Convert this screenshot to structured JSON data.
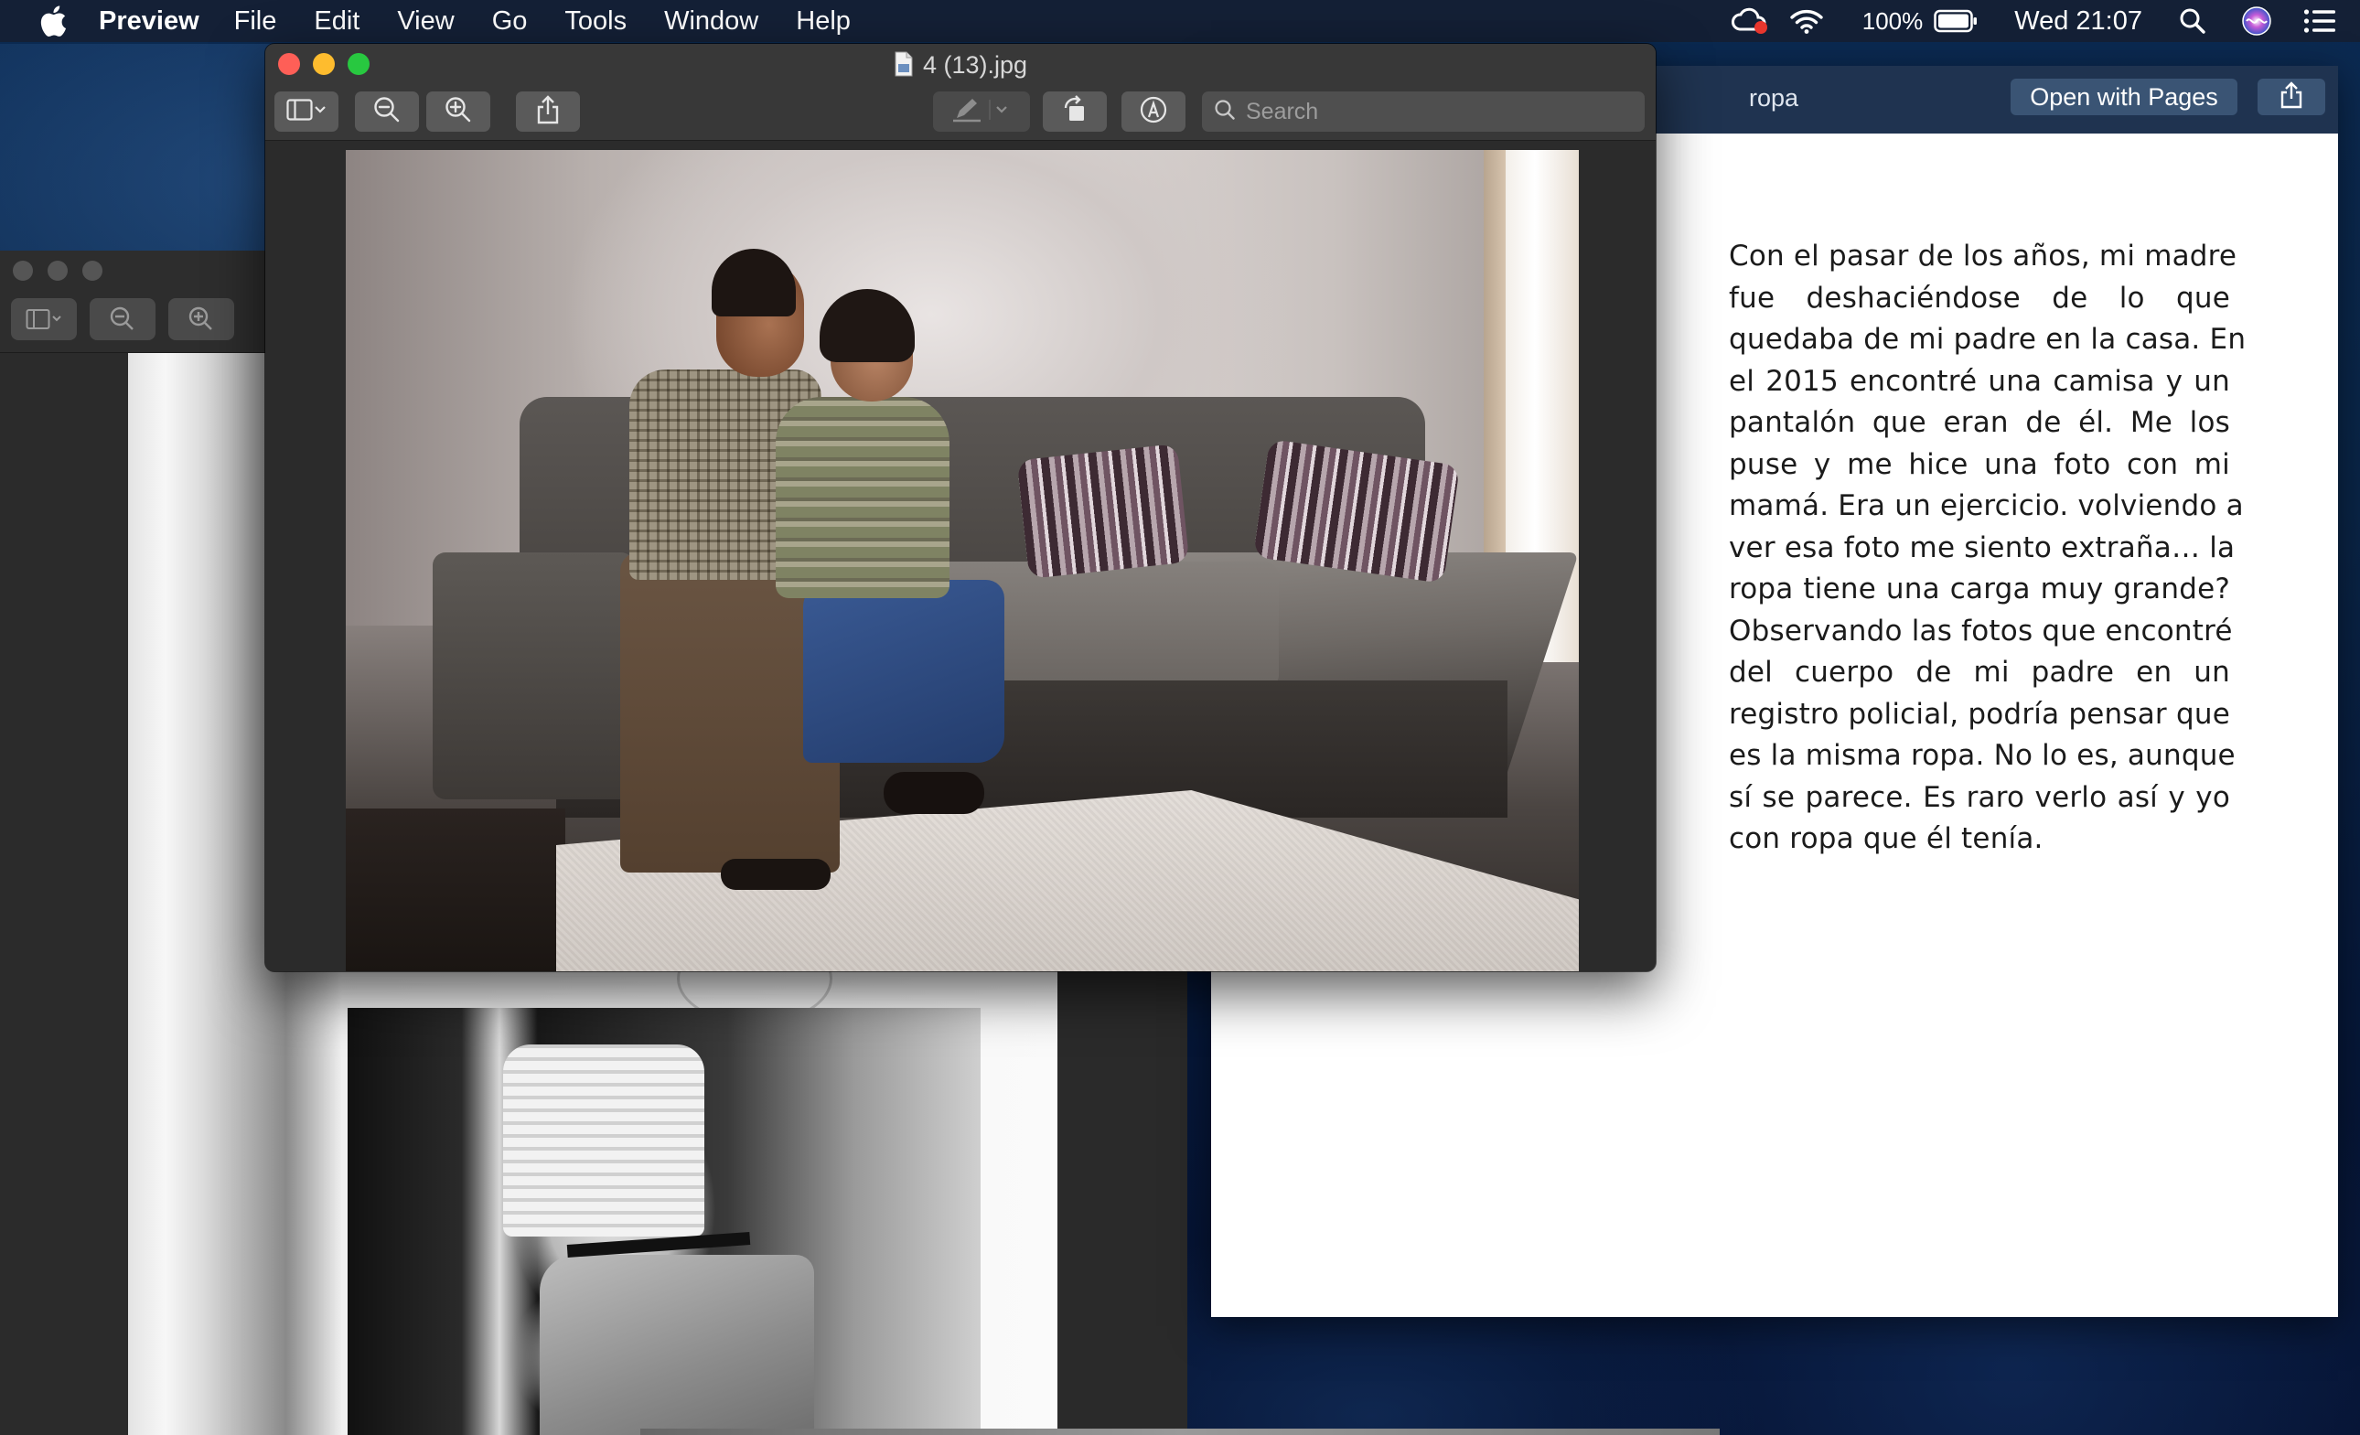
{
  "menubar": {
    "app_name": "Preview",
    "menus": [
      "File",
      "Edit",
      "View",
      "Go",
      "Tools",
      "Window",
      "Help"
    ],
    "battery_percent": "100%",
    "clock": "Wed 21:07",
    "icons": [
      "apple-logo-icon",
      "creative-cloud-icon",
      "wifi-icon",
      "battery-icon",
      "spotlight-search-icon",
      "siri-icon",
      "notification-center-icon"
    ]
  },
  "preview_window": {
    "title": "4 (13).jpg",
    "toolbar": {
      "sidebar_button": "sidebar-toggle-icon",
      "zoom_out": "zoom-out-icon",
      "zoom_in": "zoom-in-icon",
      "share": "share-icon",
      "markup_pen": "pen-icon",
      "rotate": "rotate-left-icon",
      "markup": "markup-icon"
    },
    "search": {
      "placeholder": "Search",
      "value": ""
    }
  },
  "doc_window": {
    "title": "ropa",
    "open_button": "Open with Pages",
    "lines": [
      "Con el pasar de los años, mi madre",
      "fue deshaciéndose de lo que",
      "quedaba de mi padre en la casa. En",
      "el 2015 encontré una camisa y un",
      "pantalón que eran de él. Me los",
      "puse y me hice una foto con mi",
      "mamá. Era un ejercicio. volviendo a",
      "ver esa foto me siento extraña… la",
      "ropa tiene una carga muy grande?",
      "Observando las fotos que encontré",
      "del cuerpo de mi padre en un",
      "registro policial, podría pensar que",
      "es la misma ropa. No lo es, aunque",
      "sí se parece. Es raro verlo así y yo",
      "con ropa que él tenía."
    ]
  },
  "colors": {
    "menubar_bg": "#16203a",
    "window_chrome": "#383838",
    "close": "#fe5f57",
    "minimize": "#febc2e",
    "maximize": "#28c840",
    "doc_header": "#1f3350",
    "doc_button": "#3a5474"
  }
}
